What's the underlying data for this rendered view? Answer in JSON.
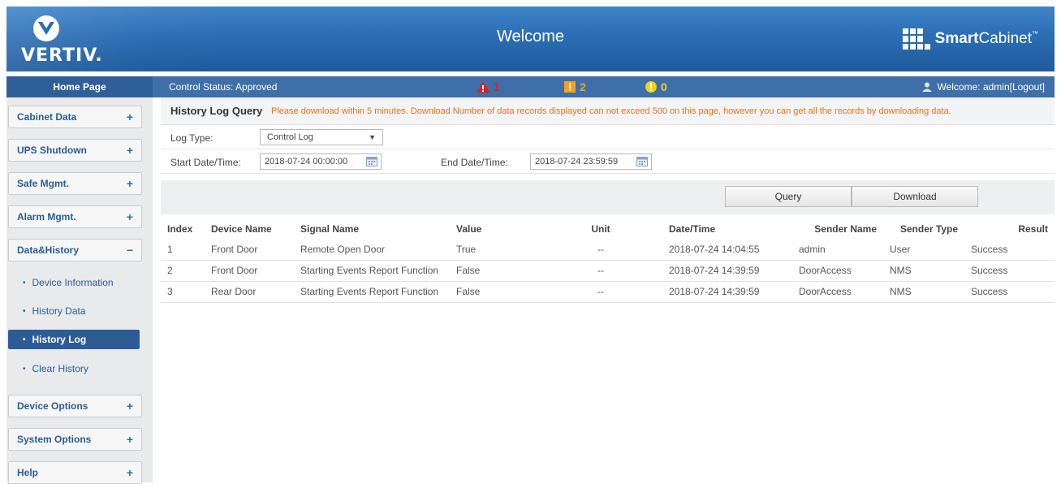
{
  "header": {
    "logo_text": "VERTIV.",
    "title": "Welcome",
    "brand_bold": "Smart",
    "brand_regular": "Cabinet",
    "brand_tm": "™"
  },
  "statusbar": {
    "home_tab": "Home Page",
    "control_status": "Control Status:  Approved",
    "alarms": [
      {
        "icon": "critical-triangle-icon",
        "count": "1",
        "color": "#e02020"
      },
      {
        "icon": "major-square-icon",
        "count": "2",
        "color": "#f5a023"
      },
      {
        "icon": "minor-circle-icon",
        "count": "0",
        "color": "#f2d21b"
      }
    ],
    "welcome": "Welcome: admin[Logout]"
  },
  "sidebar": {
    "items": [
      {
        "label": "Cabinet Data",
        "sign": "+"
      },
      {
        "label": "UPS Shutdown",
        "sign": "+"
      },
      {
        "label": "Safe Mgmt.",
        "sign": "+"
      },
      {
        "label": "Alarm Mgmt.",
        "sign": "+"
      },
      {
        "label": "Data&History",
        "sign": "−"
      },
      {
        "label": "Device Options",
        "sign": "+"
      },
      {
        "label": "System Options",
        "sign": "+"
      },
      {
        "label": "Help",
        "sign": "+"
      }
    ],
    "subitems": [
      {
        "label": "Device Information"
      },
      {
        "label": "History Data"
      },
      {
        "label": "History Log"
      },
      {
        "label": "Clear History"
      }
    ]
  },
  "query": {
    "title": "History Log Query",
    "note": "Please download within 5 minutes. Download Number of data records displayed can not exceed 500 on this page, however you can get all the records by downloading data.",
    "log_type_label": "Log Type:",
    "log_type_value": "Control Log",
    "start_label": "Start Date/Time:",
    "start_value": "2018-07-24 00:00:00",
    "end_label": "End Date/Time:",
    "end_value": "2018-07-24 23:59:59",
    "query_button": "Query",
    "download_button": "Download"
  },
  "table": {
    "columns": [
      "Index",
      "Device Name",
      "Signal Name",
      "Value",
      "Unit",
      "Date/Time",
      "Sender Name",
      "Sender Type",
      "Result"
    ],
    "rows": [
      [
        "1",
        "Front Door",
        "Remote Open Door",
        "True",
        "--",
        "2018-07-24 14:04:55",
        "admin",
        "User",
        "Success"
      ],
      [
        "2",
        "Front Door",
        "Starting Events Report Function",
        "False",
        "--",
        "2018-07-24 14:39:59",
        "DoorAccess",
        "NMS",
        "Success"
      ],
      [
        "3",
        "Rear Door",
        "Starting Events Report Function",
        "False",
        "--",
        "2018-07-24 14:39:59",
        "DoorAccess",
        "NMS",
        "Success"
      ]
    ]
  }
}
